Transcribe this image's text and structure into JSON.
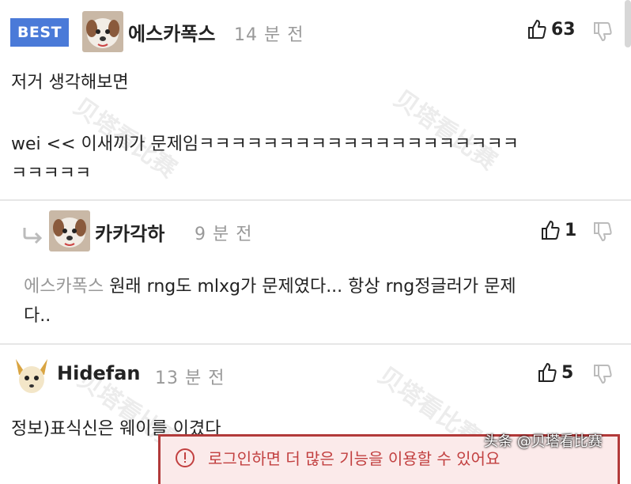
{
  "comments": [
    {
      "badge": "BEST",
      "username": "에스카폭스",
      "time": "14 분 전",
      "likes": "63",
      "body_lines": [
        "저거 생각해보면",
        "",
        "wei << 이새끼가 문제임ㅋㅋㅋㅋㅋㅋㅋㅋㅋㅋㅋㅋㅋㅋㅋㅋㅋㅋㅋㅋ",
        "ㅋㅋㅋㅋㅋ"
      ]
    },
    {
      "username": "카카각하",
      "time": "9 분 전",
      "likes": "1",
      "mention": "에스카폭스",
      "body_line1": " 원래 rng도 mlxg가 문제였다... 항상 rng정글러가 문제",
      "body_line2": "다.."
    },
    {
      "username": "Hidefan",
      "time": "13 분 전",
      "likes": "5",
      "body_line1": "정보)표식신은 웨이를 이겼다"
    }
  ],
  "popup": {
    "text": "로그인하면 더 많은 기능을 이용할 수 있어요"
  },
  "watermark": "贝塔看比赛",
  "source_label": "头条 @贝塔看比赛",
  "colors": {
    "badge": "#4a7ad8",
    "muted": "#999999",
    "popup_border": "#b23a3a"
  },
  "icons": [
    "thumbs-up-icon",
    "thumbs-down-icon",
    "reply-arrow-icon",
    "avatar-image"
  ]
}
